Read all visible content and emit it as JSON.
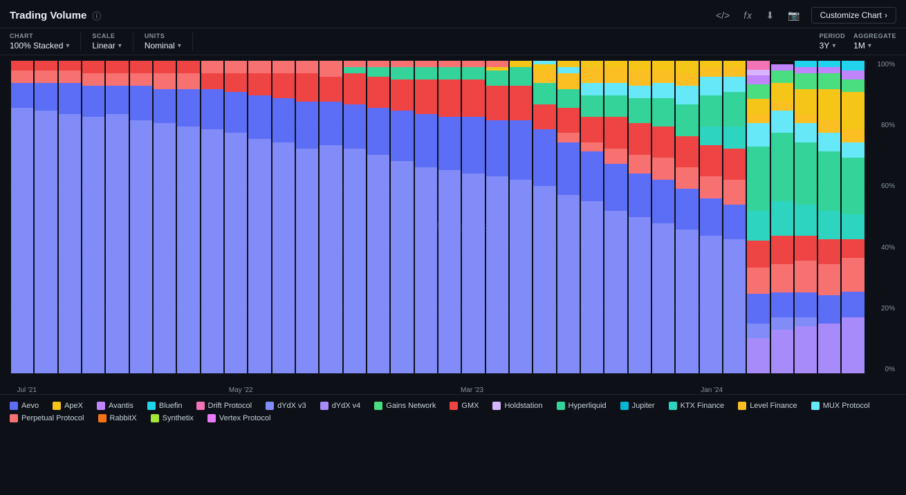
{
  "header": {
    "title": "Trading Volume",
    "customize_label": "Customize Chart",
    "customize_arrow": "›"
  },
  "toolbar": {
    "chart_label": "CHART",
    "chart_value": "100% Stacked",
    "scale_label": "SCALE",
    "scale_value": "Linear",
    "units_label": "UNITS",
    "units_value": "Nominal",
    "period_label": "PERIOD",
    "period_value": "3Y",
    "aggregate_label": "AGGREGATE",
    "aggregate_value": "1M"
  },
  "chart": {
    "y_labels": [
      "100%",
      "80%",
      "60%",
      "40%",
      "20%",
      "0%"
    ],
    "x_labels": [
      {
        "label": "Jul '21",
        "pos": 2
      },
      {
        "label": "May '22",
        "pos": 26
      },
      {
        "label": "Mar '23",
        "pos": 53
      },
      {
        "label": "Jan '24",
        "pos": 81
      }
    ],
    "watermark": "Ⓐ Artemis"
  },
  "legend": [
    {
      "color": "#5b6ef5",
      "label": "Aevo"
    },
    {
      "color": "#f5c518",
      "label": "ApeX"
    },
    {
      "color": "#c084fc",
      "label": "Avantis"
    },
    {
      "color": "#22d3ee",
      "label": "Bluefin"
    },
    {
      "color": "#f472b6",
      "label": "Drift Protocol"
    },
    {
      "color": "#818cf8",
      "label": "dYdX v3"
    },
    {
      "color": "#a78bfa",
      "label": "dYdX v4"
    },
    {
      "color": "#4ade80",
      "label": "Gains Network"
    },
    {
      "color": "#ef4444",
      "label": "GMX"
    },
    {
      "color": "#d8b4fe",
      "label": "Holdstation"
    },
    {
      "color": "#34d399",
      "label": "Hyperliquid"
    },
    {
      "color": "#06b6d4",
      "label": "Jupiter"
    },
    {
      "color": "#2dd4bf",
      "label": "KTX Finance"
    },
    {
      "color": "#fbbf24",
      "label": "Level Finance"
    },
    {
      "color": "#67e8f9",
      "label": "MUX Protocol"
    },
    {
      "color": "#f87171",
      "label": "Perpetual Protocol"
    },
    {
      "color": "#f97316",
      "label": "RabbitX"
    },
    {
      "color": "#a3e635",
      "label": "Synthetix"
    },
    {
      "color": "#e879f9",
      "label": "Vertex Protocol"
    }
  ]
}
